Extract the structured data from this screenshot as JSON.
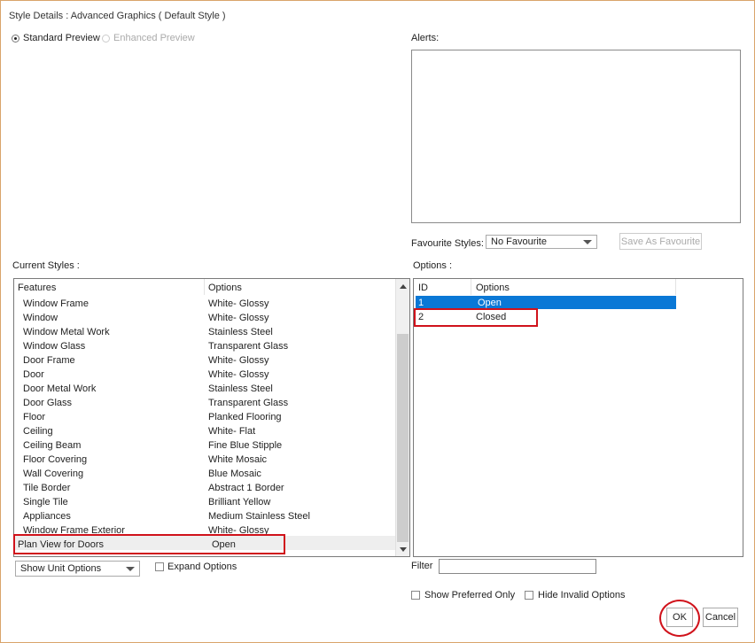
{
  "dialog": {
    "title": "Style Details : Advanced Graphics ( Default Style )"
  },
  "preview": {
    "standard_label": "Standard Preview",
    "enhanced_label": "Enhanced Preview"
  },
  "alerts": {
    "label": "Alerts:"
  },
  "favourite": {
    "label": "Favourite Styles:",
    "selected": "No Favourite",
    "save_label": "Save As Favourite"
  },
  "current_styles": {
    "label": "Current Styles :",
    "columns": [
      "Features",
      "Options"
    ],
    "rows": [
      {
        "feature": "Window Frame",
        "option": "White- Glossy"
      },
      {
        "feature": "Window",
        "option": "White- Glossy"
      },
      {
        "feature": "Window Metal Work",
        "option": "Stainless Steel"
      },
      {
        "feature": "Window Glass",
        "option": "Transparent Glass"
      },
      {
        "feature": "Door Frame",
        "option": "White- Glossy"
      },
      {
        "feature": "Door",
        "option": "White- Glossy"
      },
      {
        "feature": "Door Metal Work",
        "option": "Stainless Steel"
      },
      {
        "feature": "Door Glass",
        "option": "Transparent Glass"
      },
      {
        "feature": "Floor",
        "option": "Planked Flooring"
      },
      {
        "feature": "Ceiling",
        "option": "White- Flat"
      },
      {
        "feature": "Ceiling Beam",
        "option": "Fine Blue Stipple"
      },
      {
        "feature": "Floor Covering",
        "option": "White Mosaic"
      },
      {
        "feature": "Wall Covering",
        "option": "Blue Mosaic"
      },
      {
        "feature": "Tile Border",
        "option": "Abstract 1 Border"
      },
      {
        "feature": "Single Tile",
        "option": "Brilliant Yellow"
      },
      {
        "feature": "Appliances",
        "option": "Medium Stainless Steel"
      },
      {
        "feature": "Window Frame Exterior",
        "option": "White- Glossy"
      },
      {
        "feature": "Plan View for Doors",
        "option": "Open"
      }
    ]
  },
  "unit_options": {
    "selected": "Show Unit Options",
    "expand_label": "Expand Options"
  },
  "options_panel": {
    "label": "Options :",
    "columns": [
      "ID",
      "Options"
    ],
    "rows": [
      {
        "id": "1",
        "option": "Open"
      },
      {
        "id": "2",
        "option": "Closed"
      }
    ]
  },
  "filter": {
    "label": "Filter",
    "value": ""
  },
  "checks": {
    "preferred_label": "Show Preferred Only",
    "invalid_label": "Hide Invalid Options"
  },
  "buttons": {
    "ok_label": "OK",
    "cancel_label": "Cancel"
  },
  "colors": {
    "selection": "#0a78d6",
    "highlight": "#d0121b",
    "frame": "#d9a46a"
  }
}
